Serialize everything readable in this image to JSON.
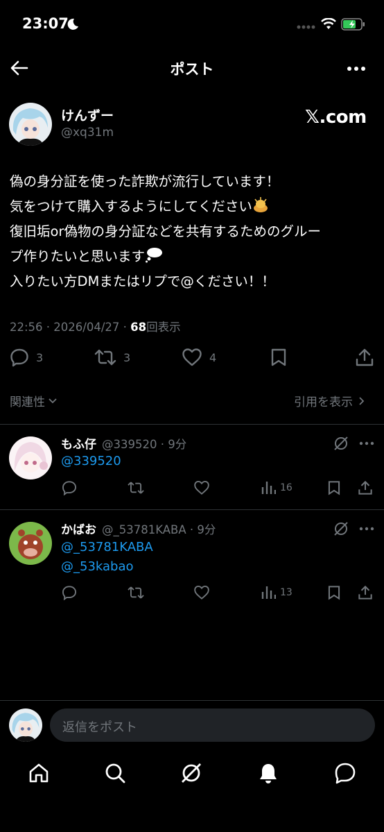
{
  "status": {
    "time": "23:07"
  },
  "header": {
    "title": "ポスト"
  },
  "post": {
    "author_name": "けんずー",
    "author_handle": "@xq31m",
    "badge": "𝕏.com",
    "lines": [
      "偽の身分証を使った詐欺が流行しています！",
      "気をつけて購入するようにしてください",
      "復旧垢or偽物の身分証などを共有するためのグルー",
      "プ作りたいと思います",
      "入りたい方DMまたはリプで@ください！！"
    ],
    "time": "22:56 · 2026/04/27 · ",
    "views_count": "68",
    "views_label": "回表示",
    "replies": "3",
    "reposts": "3",
    "likes": "4"
  },
  "filters": {
    "relevance": "関連性",
    "quotes": "引用を表示"
  },
  "replies": [
    {
      "name": "もふ仔",
      "meta": "@339520 · 9分",
      "mentions": [
        "@339520"
      ],
      "views": "16"
    },
    {
      "name": "かばお",
      "meta": "@_53781KABA · 9分",
      "mentions": [
        "@_53781KABA",
        "@_53kabao"
      ],
      "views": "13"
    }
  ],
  "composer": {
    "placeholder": "返信をポスト"
  },
  "icons": [
    "back-arrow-icon",
    "more-icon",
    "reply-icon",
    "repost-icon",
    "like-icon",
    "bookmark-icon",
    "share-icon",
    "grok-icon",
    "views-icon",
    "home-icon",
    "search-icon",
    "bell-icon",
    "messages-icon"
  ],
  "colors": {
    "accent": "#1d9bf0",
    "muted": "#71767b",
    "background": "#000000"
  }
}
